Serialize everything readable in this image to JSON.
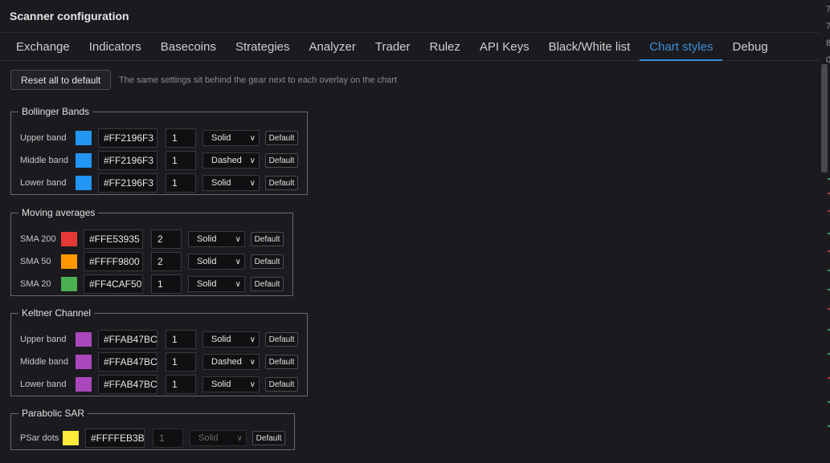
{
  "window": {
    "title": "Scanner configuration"
  },
  "tabs": [
    {
      "label": "Exchange"
    },
    {
      "label": "Indicators"
    },
    {
      "label": "Basecoins"
    },
    {
      "label": "Strategies"
    },
    {
      "label": "Analyzer"
    },
    {
      "label": "Trader"
    },
    {
      "label": "Rulez"
    },
    {
      "label": "API Keys"
    },
    {
      "label": "Black/White list"
    },
    {
      "label": "Chart styles"
    },
    {
      "label": "Debug"
    }
  ],
  "active_tab": "Chart styles",
  "toolbar": {
    "reset_label": "Reset all to default",
    "hint": "The same settings sit behind the gear next to each overlay on the chart"
  },
  "groups": [
    {
      "title": "Bollinger Bands",
      "rows": [
        {
          "label": "Upper band",
          "color": "#2196F3",
          "hex": "#FF2196F3",
          "width": "1",
          "style": "Solid",
          "default_label": "Default"
        },
        {
          "label": "Middle band",
          "color": "#2196F3",
          "hex": "#FF2196F3",
          "width": "1",
          "style": "Dashed",
          "default_label": "Default"
        },
        {
          "label": "Lower band",
          "color": "#2196F3",
          "hex": "#FF2196F3",
          "width": "1",
          "style": "Solid",
          "default_label": "Default"
        }
      ]
    },
    {
      "title": "Moving averages",
      "rows": [
        {
          "label": "SMA 200",
          "color": "#E53935",
          "hex": "#FFE53935",
          "width": "2",
          "style": "Solid",
          "default_label": "Default"
        },
        {
          "label": "SMA 50",
          "color": "#FF9800",
          "hex": "#FFFF9800",
          "width": "2",
          "style": "Solid",
          "default_label": "Default"
        },
        {
          "label": "SMA 20",
          "color": "#4CAF50",
          "hex": "#FF4CAF50",
          "width": "1",
          "style": "Solid",
          "default_label": "Default"
        }
      ]
    },
    {
      "title": "Keltner Channel",
      "rows": [
        {
          "label": "Upper band",
          "color": "#AB47BC",
          "hex": "#FFAB47BC",
          "width": "1",
          "style": "Solid",
          "default_label": "Default"
        },
        {
          "label": "Middle band",
          "color": "#AB47BC",
          "hex": "#FFAB47BC",
          "width": "1",
          "style": "Dashed",
          "default_label": "Default"
        },
        {
          "label": "Lower band",
          "color": "#AB47BC",
          "hex": "#FFAB47BC",
          "width": "1",
          "style": "Solid",
          "default_label": "Default"
        }
      ]
    },
    {
      "title": "Parabolic SAR",
      "rows": [
        {
          "label": "PSar dots",
          "color": "#FFEB3B",
          "hex": "#FFFFEB3B",
          "width": "1",
          "style": "Solid",
          "default_label": "Default",
          "width_disabled": true,
          "style_disabled": true
        }
      ]
    }
  ],
  "edge_readout": [
    "7",
    "7",
    "8",
    "0"
  ],
  "colors": {
    "background": "#1b1b1f",
    "accent": "#3b8fd6",
    "edge_green": "#2e9e6a",
    "edge_red": "#b23a3a"
  }
}
